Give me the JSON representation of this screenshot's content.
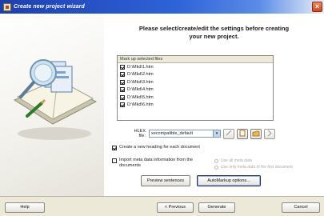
{
  "window": {
    "title": "Create new project wizard",
    "close_label": "×"
  },
  "main": {
    "heading_line1": "Please select/create/edit the settings before creating",
    "heading_line2": "your new project.",
    "file_list": {
      "header": "Mark up selected files",
      "files": [
        {
          "name": "D:\\Mkd\\1.htm",
          "checked": true
        },
        {
          "name": "D:\\Mkd\\2.htm",
          "checked": true
        },
        {
          "name": "D:\\Mkd\\3.htm",
          "checked": true
        },
        {
          "name": "D:\\Mkd\\4.htm",
          "checked": true
        },
        {
          "name": "D:\\Mkd\\5.htm",
          "checked": true
        },
        {
          "name": "D:\\Mkd\\6.htm",
          "checked": true
        }
      ]
    },
    "hlex": {
      "label": "HLEX file:",
      "selected": "xecompatible_default",
      "arrow": "▾"
    },
    "options": {
      "create_heading": "Create a new heading for each document",
      "import_meta": "Import meta data information from the documents",
      "radio_1": "Use all meta data",
      "radio_2": "Use only meta data of the first document"
    },
    "buttons": {
      "preview": "Preview sentences",
      "automarkup": "AutoMarkup options..."
    }
  },
  "footer": {
    "help": "Help",
    "previous": "< Previous",
    "generate": "Generate",
    "cancel": "Cancel"
  }
}
